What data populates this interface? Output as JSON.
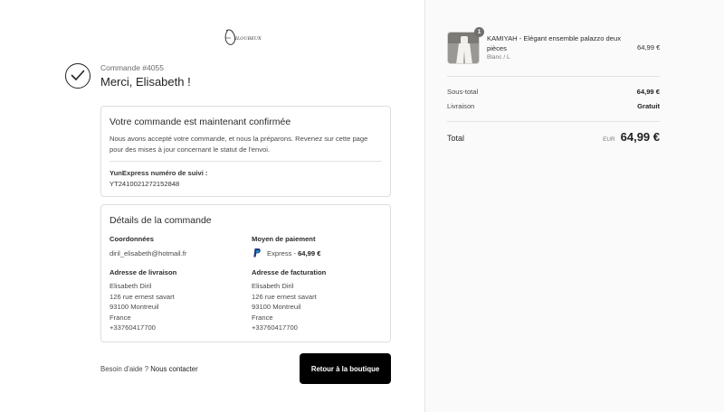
{
  "logo": {
    "text": "DILOUBEUX"
  },
  "order": {
    "number": "Commande #4055",
    "thanks": "Merci, Elisabeth !"
  },
  "confirmation": {
    "title": "Votre commande est maintenant confirmée",
    "text": "Nous avons accepté votre commande, et nous la préparons. Revenez sur cette page pour des mises à jour concernant le statut de l'envoi.",
    "tracking_label": "YunExpress numéro de suivi :",
    "tracking_number": "YT2410021272152848"
  },
  "details": {
    "title": "Détails de la commande",
    "contact_heading": "Coordonnées",
    "contact_email": "diril_elisabeth@hotmail.fr",
    "payment_heading": "Moyen de paiement",
    "payment_method": "Express -",
    "payment_amount": "64,99 €",
    "shipping_heading": "Adresse de livraison",
    "shipping_address": [
      "Elisabeth Diril",
      "126 rue ernest savart",
      "93100 Montreuil",
      "France",
      "+33760417700"
    ],
    "billing_heading": "Adresse de facturation",
    "billing_address": [
      "Elisabeth Diril",
      "126 rue ernest savart",
      "93100 Montreuil",
      "France",
      "+33760417700"
    ]
  },
  "footer": {
    "help_text": "Besoin d'aide ?",
    "contact_link": "Nous contacter",
    "return_button": "Retour à la boutique"
  },
  "summary": {
    "product": {
      "quantity": "1",
      "name": "KAMIYAH - Elégant ensemble palazzo deux pièces",
      "variant": "Blanc / L",
      "price": "64,99 €"
    },
    "subtotal_label": "Sous-total",
    "subtotal_value": "64,99 €",
    "shipping_label": "Livraison",
    "shipping_value": "Gratuit",
    "total_label": "Total",
    "currency": "EUR",
    "total_value": "64,99 €"
  },
  "colors": {
    "button_bg": "#000000",
    "sidebar_bg": "#fafafa",
    "paypal_blue": "#253b80",
    "paypal_light": "#179bd7"
  }
}
